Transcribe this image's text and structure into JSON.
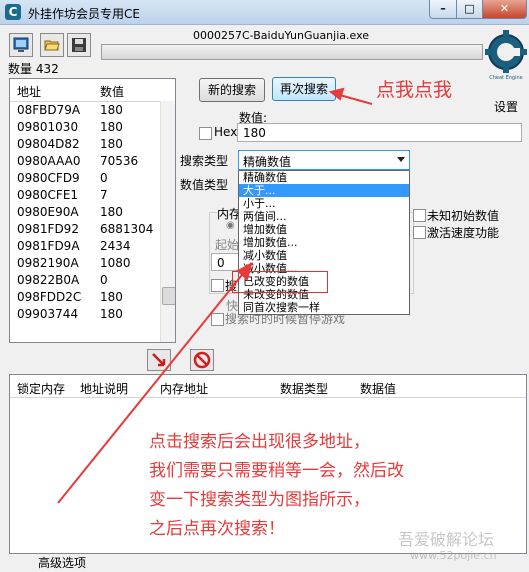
{
  "window": {
    "title": "外挂作坊会员专用CE",
    "min": "–",
    "max": "□",
    "close": "✕"
  },
  "toolbar": {
    "process_name": "0000257C-BaiduYunGuanjia.exe",
    "count_label": "数量",
    "count_value": "432",
    "settings_label": "设置",
    "logo_caption": "Cheat Engine"
  },
  "address_list": {
    "headers": [
      "地址",
      "数值"
    ],
    "rows": [
      {
        "addr": "08FBD79A",
        "val": "180"
      },
      {
        "addr": "09801030",
        "val": "180"
      },
      {
        "addr": "09804D82",
        "val": "180"
      },
      {
        "addr": "0980AAA0",
        "val": "70536"
      },
      {
        "addr": "0980CFD9",
        "val": "0"
      },
      {
        "addr": "0980CFE1",
        "val": "7"
      },
      {
        "addr": "0980E90A",
        "val": "180"
      },
      {
        "addr": "0981FD92",
        "val": "6881304"
      },
      {
        "addr": "0981FD9A",
        "val": "2434"
      },
      {
        "addr": "0982190A",
        "val": "1080"
      },
      {
        "addr": "09822B0A",
        "val": "0"
      },
      {
        "addr": "098FDD2C",
        "val": "180"
      },
      {
        "addr": "09903744",
        "val": "180"
      }
    ]
  },
  "search": {
    "new_scan": "新的搜索",
    "next_scan": "再次搜索",
    "value_label": "数值:",
    "hex_label": "Hex",
    "value": "180",
    "scan_type_label": "搜索类型",
    "scan_type_selected": "精确数值",
    "value_type_label": "数值类型",
    "options": [
      "精确数值",
      "大于...",
      "小于...",
      "两值间...",
      "增加数值",
      "增加数值...",
      "减小数值",
      "减小数值...",
      "已改变的数值",
      "未改变的数值",
      "同首次搜索一样"
    ],
    "selected_option_index": 1,
    "highlighted_option": "已改变的数值",
    "memory_label": "内存",
    "start_label": "起始",
    "start_value": "0",
    "partial_left1": "搜",
    "partial_left2": "快",
    "pause_label": "搜索时的时候暂停游戏",
    "unknown_init_label": "未知初始数值",
    "speedhack_label": "激活速度功能"
  },
  "bottom_list": {
    "headers": [
      "锁定内存",
      "地址说明",
      "内存地址",
      "数据类型",
      "数据值"
    ]
  },
  "footer": {
    "advanced": "高级选项"
  },
  "annotations": {
    "top": "点我点我",
    "lines": [
      "点击搜索后会出现很多地址，",
      "我们需要只需要稍等一会，然后改",
      "变一下搜索类型为图指所示，",
      "之后点再次搜索！"
    ]
  },
  "watermark": {
    "main": "吾爱破解论坛",
    "url": "www.52pojie.cn"
  },
  "colors": {
    "annotation": "#e83a3a",
    "selection": "#3399ff"
  }
}
